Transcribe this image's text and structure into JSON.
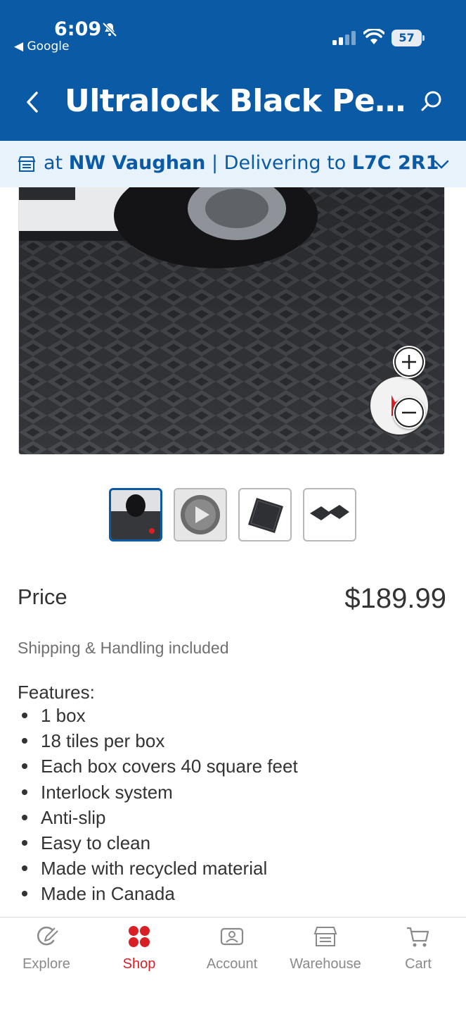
{
  "status_bar": {
    "time": "6:09",
    "back_app": "Google",
    "battery": "57"
  },
  "header": {
    "title": "Ultralock Black Perforated Garage Floor Tiles"
  },
  "location": {
    "prefix": "at",
    "store": "NW Vaughan",
    "separator": "|",
    "delivering_label": "Delivering to",
    "postal": "L7C 2R1"
  },
  "gallery": {
    "thumbnails": [
      "image-1",
      "video",
      "image-3",
      "image-4"
    ],
    "selected_index": 0
  },
  "price": {
    "label": "Price",
    "value": "$189.99",
    "shipping": "Shipping & Handling included"
  },
  "features": {
    "title": "Features:",
    "items": [
      "1 box",
      "18 tiles per box",
      "Each box covers 40 square feet",
      "Interlock system",
      "Anti-slip",
      "Easy to clean",
      "Made with recycled material",
      "Made in Canada"
    ]
  },
  "bottom_nav": {
    "tabs": [
      {
        "label": "Explore",
        "icon": "explore-icon"
      },
      {
        "label": "Shop",
        "icon": "shop-icon"
      },
      {
        "label": "Account",
        "icon": "account-icon"
      },
      {
        "label": "Warehouse",
        "icon": "warehouse-icon"
      },
      {
        "label": "Cart",
        "icon": "cart-icon"
      }
    ],
    "active": "Shop"
  },
  "colors": {
    "brand_blue": "#0a5aa6",
    "active_red": "#d81f26",
    "location_bg": "#e8f2fb"
  }
}
